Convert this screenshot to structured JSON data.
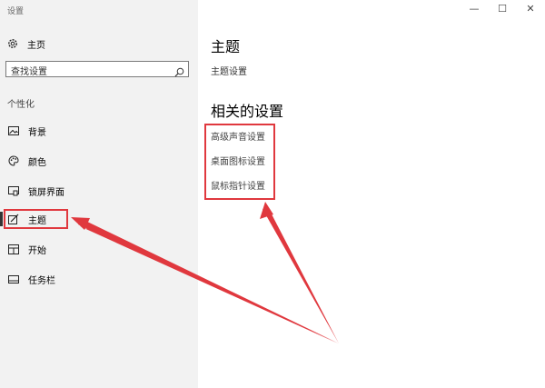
{
  "window": {
    "title": "设置",
    "minimize": "—",
    "maximize": "☐",
    "close": "✕"
  },
  "sidebar": {
    "home_label": "主页",
    "search_placeholder": "查找设置",
    "section_header": "个性化",
    "items": [
      {
        "label": "背景",
        "icon": "picture-icon"
      },
      {
        "label": "颜色",
        "icon": "palette-icon"
      },
      {
        "label": "锁屏界面",
        "icon": "lock-screen-icon"
      },
      {
        "label": "主题",
        "icon": "theme-icon",
        "selected": true
      },
      {
        "label": "开始",
        "icon": "start-icon"
      },
      {
        "label": "任务栏",
        "icon": "taskbar-icon"
      }
    ]
  },
  "main": {
    "title": "主题",
    "theme_settings_link": "主题设置",
    "related_title": "相关的设置",
    "related_links": [
      "高级声音设置",
      "桌面图标设置",
      "鼠标指针设置"
    ]
  },
  "colors": {
    "annotation_red": "#e0383e",
    "sidebar_bg": "#f2f2f2"
  }
}
